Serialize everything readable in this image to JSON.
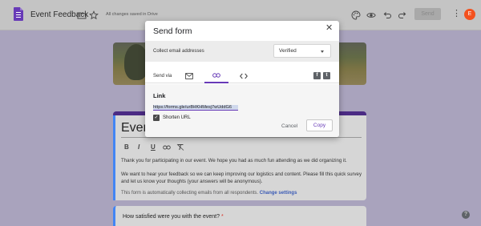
{
  "header": {
    "doc_title": "Event Feedback",
    "saved_status": "All changes saved in Drive",
    "send_label": "Send",
    "avatar_initial": "E"
  },
  "dialog": {
    "title": "Send form",
    "collect_label": "Collect email addresses",
    "collect_value": "Verified",
    "send_via_label": "Send via",
    "link_header": "Link",
    "link_url": "https://forms.gle/ur8HKHMesj7wUddG6",
    "shorten_label": "Shorten URL",
    "cancel_label": "Cancel",
    "copy_label": "Copy"
  },
  "form": {
    "title": "Event",
    "description_1": "Thank you for participating in our event. We hope you had as much fun attending as we did organizing it.",
    "description_2": "We want to hear your feedback so we can keep improving our logistics and content. Please fill this quick survey and let us know your thoughts (your answers will be anonymous).",
    "auto_email_notice": "This form is automatically collecting emails from all respondents.",
    "change_settings": "Change settings",
    "question_1": "How satisfied were you with the event?",
    "required_mark": "*"
  },
  "colors": {
    "accent": "#673ab7",
    "header_band": "#4b2b84",
    "link": "#3b5bb5",
    "focus_bar": "#4285f4"
  }
}
